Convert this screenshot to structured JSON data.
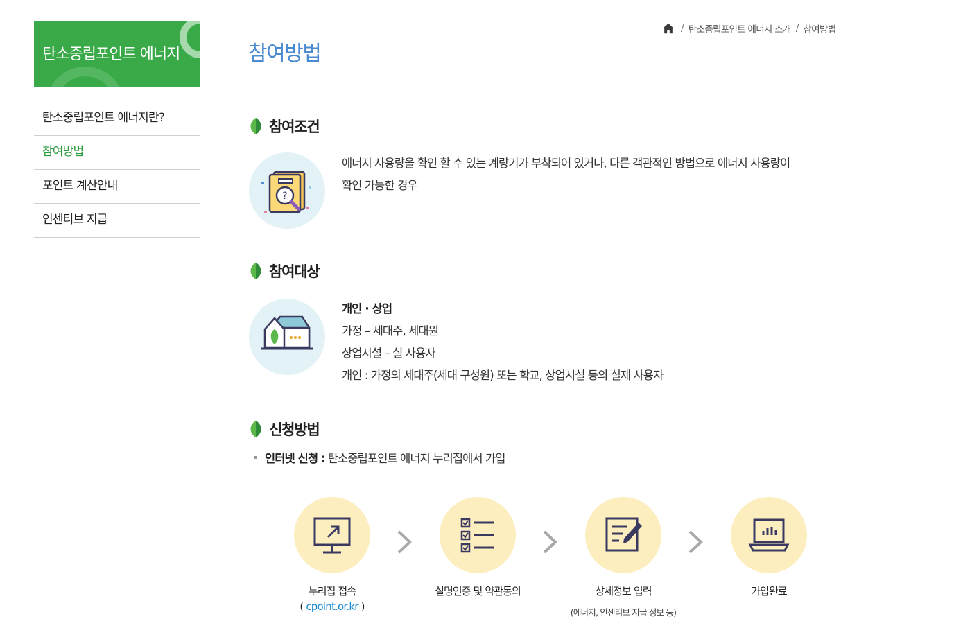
{
  "sidebar": {
    "title": "탄소중립포인트 에너지",
    "items": [
      {
        "label": "탄소중립포인트 에너지란?"
      },
      {
        "label": "참여방법"
      },
      {
        "label": "포인트 계산안내"
      },
      {
        "label": "인센티브 지급"
      }
    ]
  },
  "breadcrumb": {
    "items": [
      "탄소중립포인트 에너지 소개",
      "참여방법"
    ],
    "separator": "/"
  },
  "page": {
    "title": "참여방법"
  },
  "sections": {
    "condition": {
      "heading": "참여조건",
      "text_line1": "에너지 사용량을 확인 할 수 있는 계량기가 부착되어 있거나, 다른 객관적인 방법으로 에너지 사용량이",
      "text_line2": "확인 가능한 경우"
    },
    "target": {
      "heading": "참여대상",
      "title": "개인 · 상업",
      "line1": "가정 – 세대주, 세대원",
      "line2": "상업시설 – 실 사용자",
      "line3": "개인 : 가정의 세대주(세대 구성원) 또는 학교, 상업시설 등의 실제 사용자"
    },
    "apply": {
      "heading": "신청방법",
      "bullet_bold": "인터넷 신청 :",
      "bullet_text": "탄소중립포인트 에너지 누리집에서 가입"
    }
  },
  "steps": [
    {
      "label": "누리집 접속",
      "paren_open": "(",
      "link": "cpoint.or.kr",
      "paren_close": ")"
    },
    {
      "label": "실명인증 및 약관동의"
    },
    {
      "label": "상세정보 입력",
      "sub": "(에너지, 인센티브 지급 정보 등)"
    },
    {
      "label": "가입완료"
    }
  ],
  "colors": {
    "brand_green": "#3aaa48",
    "active_green": "#2a9a3c",
    "title_blue": "#4a8ad0",
    "step_bg": "#fdeec0",
    "icon_bg": "#e3f2f6",
    "link_blue": "#1a8cd0"
  }
}
